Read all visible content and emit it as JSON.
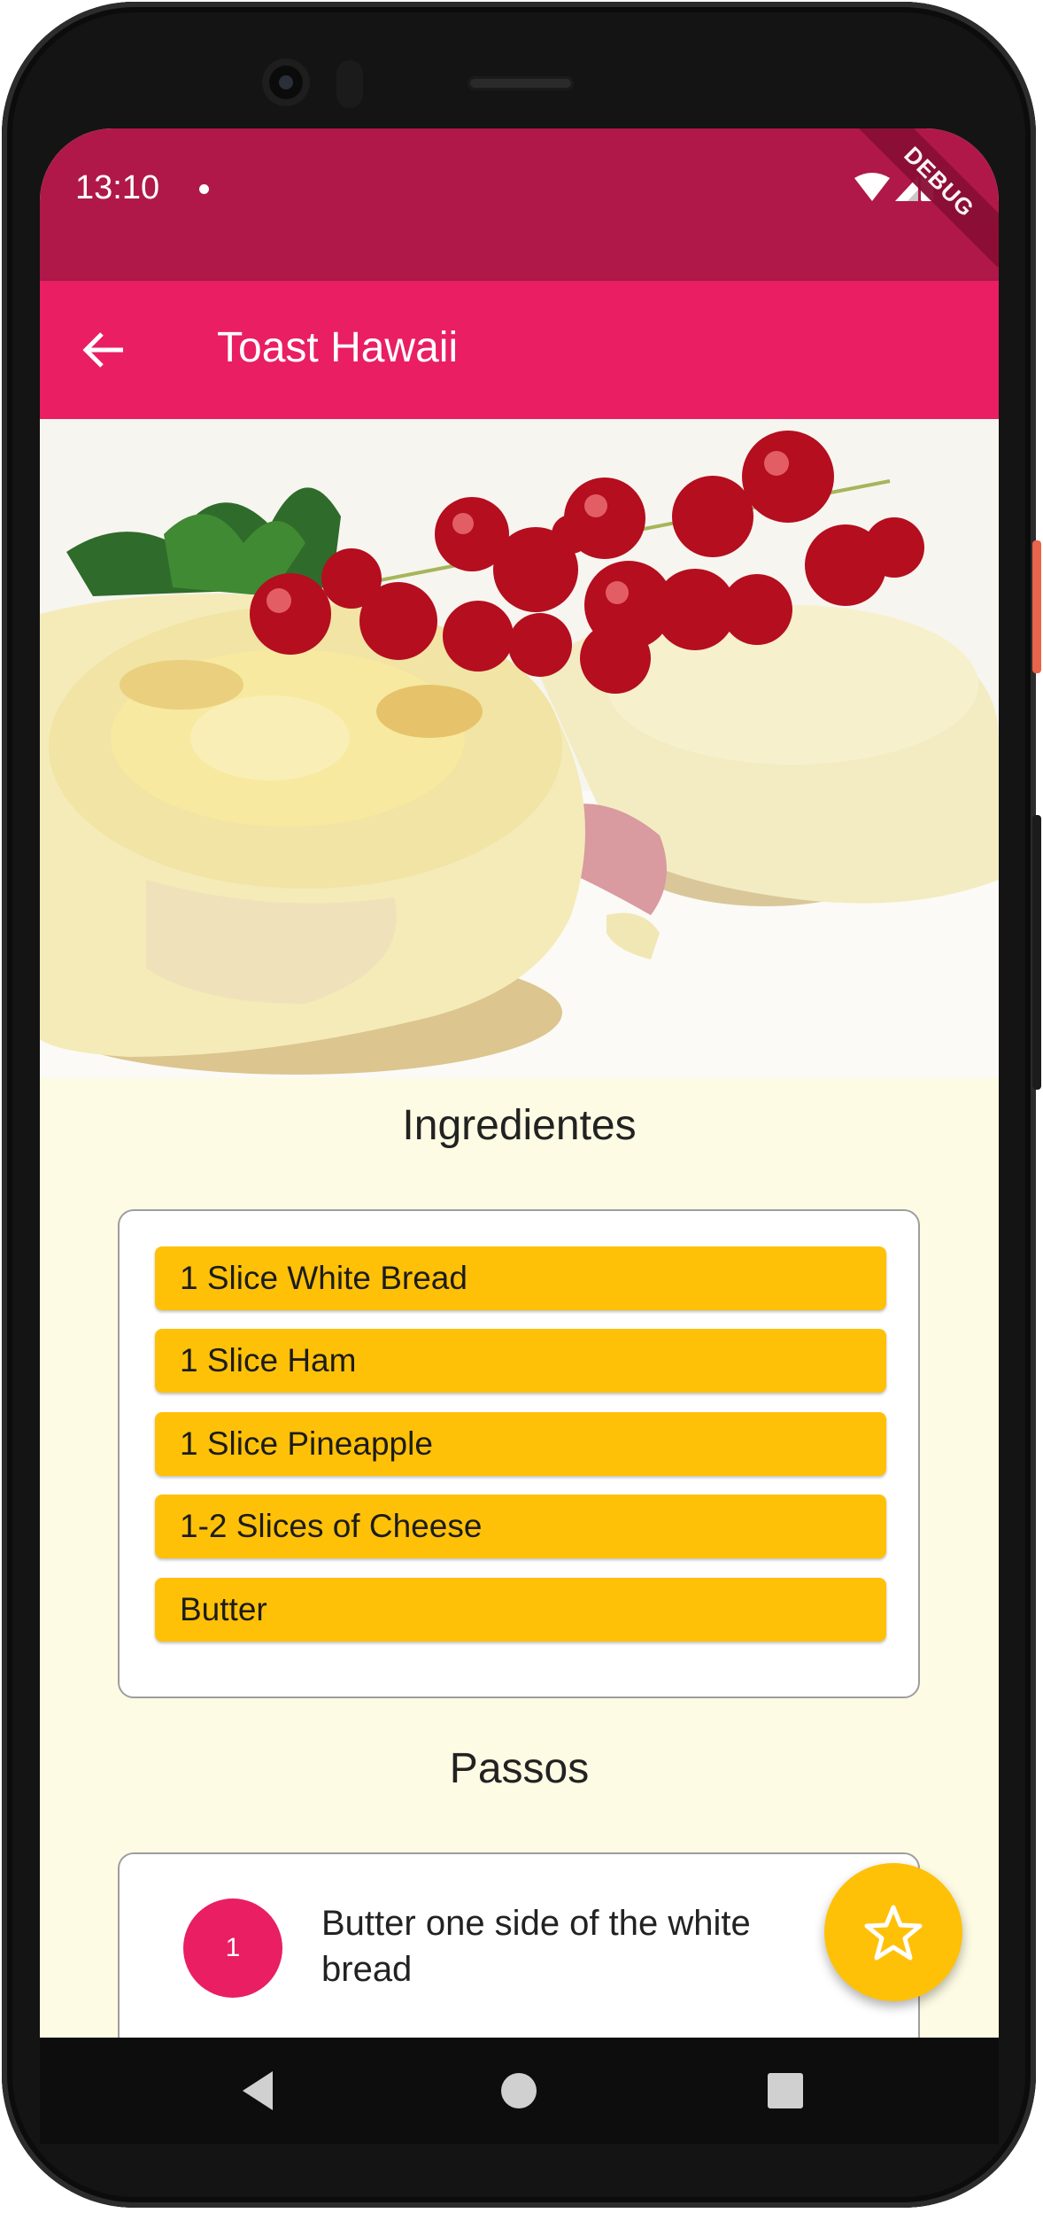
{
  "status_bar": {
    "time": "13:10",
    "debug_banner": "DEBUG"
  },
  "app_bar": {
    "title": "Toast Hawaii",
    "back_icon": "arrow-back-icon"
  },
  "hero_image": {
    "subject": "toast-hawaii-photo"
  },
  "ingredients": {
    "title": "Ingredientes",
    "items": [
      "1 Slice White Bread",
      "1 Slice Ham",
      "1 Slice Pineapple",
      "1-2 Slices of Cheese",
      "Butter"
    ]
  },
  "steps": {
    "title": "Passos",
    "items": [
      {
        "number": "1",
        "text": "Butter one side of the white bread"
      }
    ]
  },
  "fab": {
    "icon": "star-outline-icon"
  },
  "colors": {
    "status_bar": "#b0184a",
    "app_bar": "#e91e63",
    "background": "#fdfbe3",
    "ingredient_chip": "#ffc107",
    "step_circle": "#e91e63",
    "fab": "#ffc107"
  }
}
